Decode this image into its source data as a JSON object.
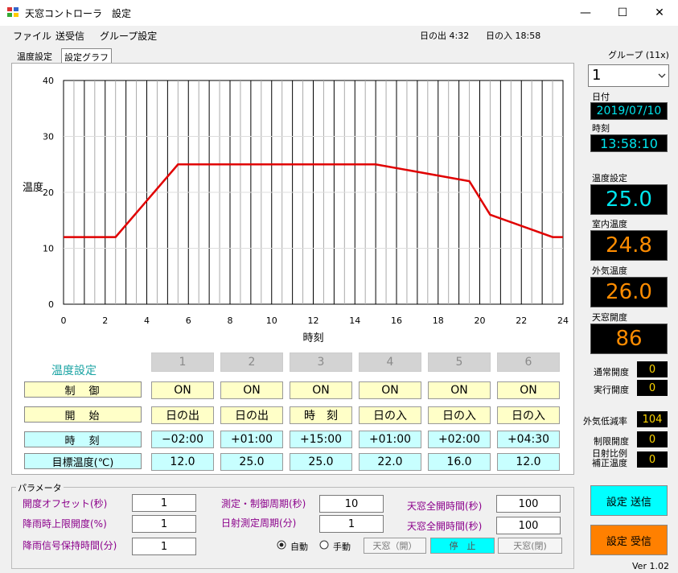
{
  "window": {
    "title": "天窓コントローラ　設定",
    "minimize_glyph": "—",
    "maximize_glyph": "☐",
    "close_glyph": "✕"
  },
  "menu": {
    "file": "ファイル",
    "transfer": "送受信",
    "group_settings": "グループ設定",
    "sunrise": "日の出 4:32",
    "sunset": "日の入 18:58"
  },
  "tabs": {
    "temp_settings": "温度設定",
    "graph": "設定グラフ"
  },
  "chart_data": {
    "type": "line",
    "xlabel": "時刻",
    "ylabel": "温度",
    "xlim": [
      0,
      24
    ],
    "ylim": [
      0,
      40
    ],
    "x_ticks": [
      "0",
      "2",
      "4",
      "6",
      "8",
      "10",
      "12",
      "14",
      "16",
      "18",
      "20",
      "22",
      "24"
    ],
    "y_ticks": [
      "0",
      "10",
      "20",
      "30",
      "40"
    ],
    "grid": true,
    "series": [
      {
        "color": "#e00000",
        "points": [
          [
            0,
            12
          ],
          [
            2.5,
            12
          ],
          [
            5.5,
            25
          ],
          [
            15,
            25
          ],
          [
            19.5,
            22
          ],
          [
            20.5,
            16
          ],
          [
            23.5,
            12
          ],
          [
            24,
            12
          ]
        ]
      }
    ]
  },
  "table": {
    "title": "温度設定",
    "row_labels": {
      "control": "制　御",
      "start": "開　始",
      "time": "時　刻",
      "target": "目標温度(℃)"
    },
    "columns": [
      {
        "num": "1",
        "control": "ON",
        "start": "日の出",
        "time": "−02:00",
        "target": "12.0"
      },
      {
        "num": "2",
        "control": "ON",
        "start": "日の出",
        "time": "+01:00",
        "target": "25.0"
      },
      {
        "num": "3",
        "control": "ON",
        "start": "時　刻",
        "time": "+15:00",
        "target": "25.0"
      },
      {
        "num": "4",
        "control": "ON",
        "start": "日の入",
        "time": "+01:00",
        "target": "22.0"
      },
      {
        "num": "5",
        "control": "ON",
        "start": "日の入",
        "time": "+02:00",
        "target": "16.0"
      },
      {
        "num": "6",
        "control": "ON",
        "start": "日の入",
        "time": "+04:30",
        "target": "12.0"
      }
    ]
  },
  "params": {
    "title": "パラメータ",
    "open_offset_label": "開度オフセット(秒)",
    "open_offset": "1",
    "rain_limit_label": "降雨時上限開度(%)",
    "rain_limit": "1",
    "rain_hold_label": "降雨信号保持時間(分)",
    "rain_hold": "1",
    "measure_period_label": "測定・制御周期(秒)",
    "measure_period": "10",
    "solar_period_label": "日射測定周期(分)",
    "solar_period": "1",
    "full_open_label": "天窓全開時間(秒)",
    "full_open": "100",
    "full_open2_label": "天窓全開時間(秒)",
    "full_open2": "100",
    "mode_auto": "自動",
    "mode_manual": "手動",
    "btn_open": "天窓（開）",
    "btn_stop": "停　止",
    "btn_close": "天窓(閉)"
  },
  "side": {
    "group_label": "グループ (11x)",
    "group_value": "1",
    "date_label": "日付",
    "date": "2019/07/10",
    "time_label": "時刻",
    "time": "13:58:10",
    "set_temp_label": "温度設定",
    "set_temp": "25.0",
    "room_temp_label": "室内温度",
    "room_temp": "24.8",
    "out_temp_label": "外気温度",
    "out_temp": "26.0",
    "window_open_label": "天窓開度",
    "window_open": "86",
    "normal_open_label": "通常開度",
    "normal_open": "0",
    "actual_open_label": "実行開度",
    "actual_open": "0",
    "out_decay_label": "外気低減率",
    "out_decay": "104",
    "limit_open_label": "制限開度",
    "limit_open": "0",
    "solar_label_1": "日射比例",
    "solar_label_2": "補正温度",
    "solar_value": "0",
    "send_btn": "設定  送信",
    "recv_btn": "設定  受信",
    "version": "Ver  1.02",
    "colors": {
      "cyan": "#00e5ee",
      "orange": "#ff8c00",
      "send_bg": "#00ffff",
      "recv_bg": "#ff8000"
    }
  }
}
